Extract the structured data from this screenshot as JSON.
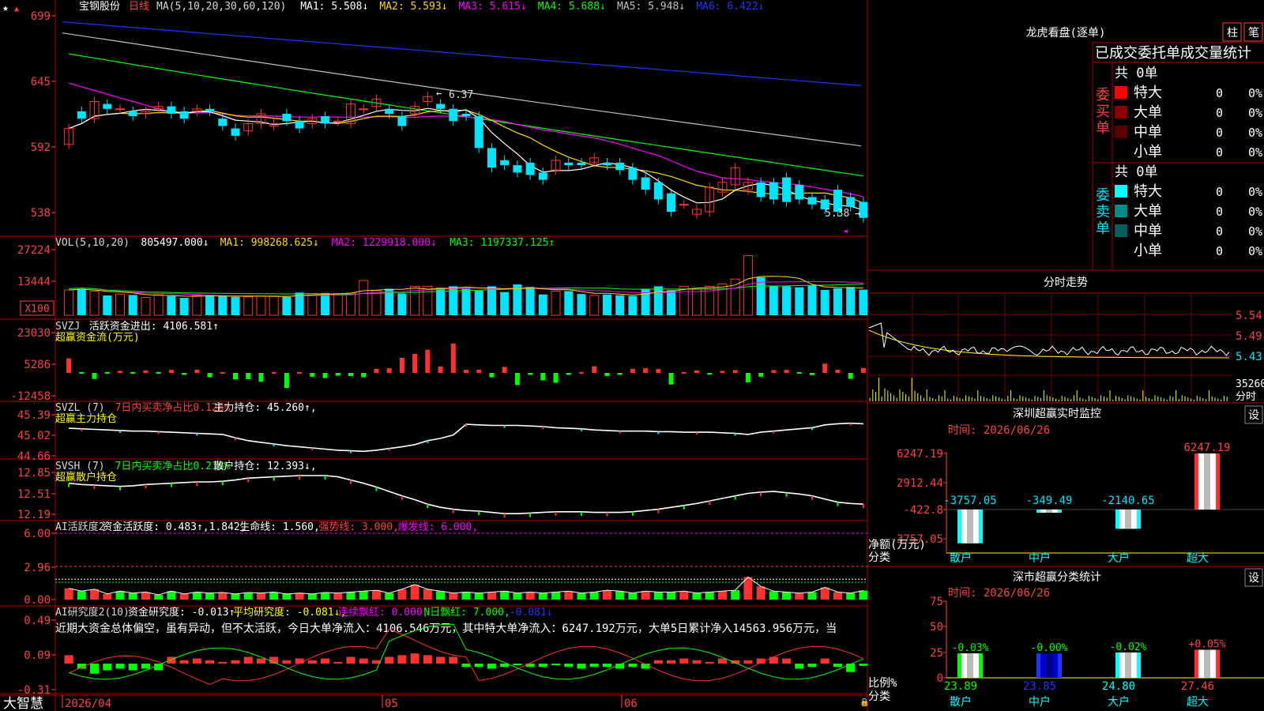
{
  "app": {
    "brand": "大智慧"
  },
  "stock": {
    "name": "宝钢股份",
    "period": "日线"
  },
  "colors": {
    "up": "#ff3232",
    "down": "#00e5ff",
    "ma1": "#ffffff",
    "ma2": "#ffd700",
    "ma3": "#ff00ff",
    "ma4": "#00ff00",
    "ma5": "#c0c0c0",
    "ma6": "#1f35ff",
    "grid": "#b00000",
    "axis": "#ff4040",
    "green": "#00ff00",
    "yellow": "#ffff00"
  },
  "main_panel": {
    "legend": [
      {
        "text": "MA(5,10,20,30,60,120)",
        "color": "#d8d8d8"
      },
      {
        "text": "MA1: 5.508↓",
        "color": "#ffffff"
      },
      {
        "text": "MA2: 5.593↓",
        "color": "#ffd700"
      },
      {
        "text": "MA3: 5.615↓",
        "color": "#ff00ff"
      },
      {
        "text": "MA4: 5.688↓",
        "color": "#00ff00"
      },
      {
        "text": "MA5: 5.948↓",
        "color": "#c0c0c0"
      },
      {
        "text": "MA6: 6.422↓",
        "color": "#1f35ff"
      }
    ],
    "yticks": [
      "699",
      "645",
      "592",
      "538"
    ],
    "high_label": "6.37",
    "low_label": "5.38"
  },
  "vol_panel": {
    "legend": [
      {
        "text": "VOL(5,10,20)",
        "color": "#d8d8d8"
      },
      {
        "text": "805497.000↓",
        "color": "#ffffff"
      },
      {
        "text": "MA1: 998268.625↓",
        "color": "#ffd700"
      },
      {
        "text": "MA2: 1229918.000↓",
        "color": "#ff00ff"
      },
      {
        "text": "MA3: 1197337.125↑",
        "color": "#00ff00"
      }
    ],
    "yticks": [
      "27224",
      "13444"
    ],
    "unit": "X100"
  },
  "svzj_panel": {
    "legend": [
      {
        "text": "SVZJ",
        "color": "#d8d8d8"
      },
      {
        "text": "活跃资金进出: 4106.581↑",
        "color": "#ffffff"
      }
    ],
    "subtitle": "超赢资金流(万元)",
    "yticks": [
      "23030",
      "5286",
      "-12458"
    ]
  },
  "svzl_panel": {
    "legend": [
      {
        "text": "SVZL (7)",
        "color": "#d8d8d8"
      },
      {
        "text": "7日内买卖净占比0.126%",
        "color": "#ff4040"
      },
      {
        "text": "主力持仓: 45.260↑,",
        "color": "#ffffff"
      }
    ],
    "subtitle": "超赢主力持仓",
    "yticks": [
      "45.39",
      "45.02",
      "44.66"
    ]
  },
  "svsh_panel": {
    "legend": [
      {
        "text": "SVSH (7)",
        "color": "#d8d8d8"
      },
      {
        "text": "7日内买卖净占比0.216%",
        "color": "#00ff00"
      },
      {
        "text": "散户持仓: 12.393↓,",
        "color": "#ffffff"
      }
    ],
    "subtitle": "超赢散户持仓",
    "yticks": [
      "12.85",
      "12.51",
      "12.19"
    ]
  },
  "ai_panel": {
    "legend": [
      {
        "text": "AI活跃度2",
        "color": "#d8d8d8"
      },
      {
        "text": "资金活跃度: 0.483↑,1.842,",
        "color": "#ffffff"
      },
      {
        "text": "生命线: 1.560,",
        "color": "#ffffff"
      },
      {
        "text": "强势线: 3.000,",
        "color": "#ff4040"
      },
      {
        "text": "爆发线: 6.000,",
        "color": "#ff00ff"
      }
    ],
    "yticks": [
      "6.00",
      "2.96",
      "0.00"
    ]
  },
  "research_panel": {
    "legend": [
      {
        "text": "AI研究度2(10)",
        "color": "#d8d8d8"
      },
      {
        "text": "资金研究度: -0.013↑,",
        "color": "#ffffff"
      },
      {
        "text": "平均研究度: -0.081↓,",
        "color": "#ffff00"
      },
      {
        "text": "连续飘红: 0.000,",
        "color": "#ff00ff"
      },
      {
        "text": "N日飘红: 7.000,",
        "color": "#00ff00"
      },
      {
        "text": "-0.081↓",
        "color": "#1f35ff"
      }
    ],
    "comment": "近期大资金总体偏空，虽有异动，但不太活跃，今日大单净流入：4106.546万元，其中特大单净流入：6247.192万元，大单5日累计净入14563.956万元，当",
    "yticks": [
      "0.49",
      "0.09",
      "-0.31"
    ]
  },
  "xaxis": {
    "labels": [
      "2026/04",
      "05",
      "06"
    ]
  },
  "right": {
    "dragon_title": "龙虎看盘(逐单)",
    "btn_bar": "柱",
    "btn_pen": "笔",
    "stats_title": "已成交委托单成交量统计",
    "buy_group": "委买单",
    "sell_group": "委卖单",
    "buy_total": "共 0单",
    "sell_total": "共 0单",
    "buy_rows": [
      {
        "label": "特大",
        "count": "0",
        "pct": "0%",
        "color": "#ff0000"
      },
      {
        "label": "大单",
        "count": "0",
        "pct": "0%",
        "color": "#8b0000"
      },
      {
        "label": "中单",
        "count": "0",
        "pct": "0%",
        "color": "#5a0000"
      },
      {
        "label": "小单",
        "count": "0",
        "pct": "0%",
        "color": ""
      }
    ],
    "sell_rows": [
      {
        "label": "特大",
        "count": "0",
        "pct": "0%",
        "color": "#00ffff"
      },
      {
        "label": "大单",
        "count": "0",
        "pct": "0%",
        "color": "#008b8b"
      },
      {
        "label": "中单",
        "count": "0",
        "pct": "0%",
        "color": "#006060"
      },
      {
        "label": "小单",
        "count": "0",
        "pct": "0%",
        "color": ""
      }
    ],
    "minute_title": "分时走势",
    "minute_yticks": [
      "5.54",
      "5.49",
      "5.43"
    ],
    "minute_vol": "35260",
    "minute_unit": "分时",
    "monitor_title": "深圳超赢实时监控",
    "monitor_date": "时间: 2026/06/26",
    "monitor_yticks": [
      "6247.19",
      "2912.44",
      "-422.8",
      "-3757.05"
    ],
    "monitor_ylabel": "净额(万元)",
    "monitor_xlabel": "分类",
    "categories": [
      "散户",
      "中户",
      "大户",
      "超大"
    ],
    "monitor_values": [
      -3757.05,
      -349.49,
      -2140.65,
      6247.19
    ],
    "monitor_labels": [
      "-3757.05",
      "-349.49",
      "-2140.65",
      "6247.19"
    ],
    "classify_title": "深市超赢分类统计",
    "classify_date": "时间: 2026/06/26",
    "classify_yticks": [
      "75",
      "50",
      "25",
      "0"
    ],
    "classify_ylabel": "比例%",
    "classify_xlabel": "分类",
    "classify_values": [
      23.89,
      23.85,
      24.8,
      27.46
    ],
    "classify_value_labels": [
      "23.89",
      "23.85",
      "24.80",
      "27.46"
    ],
    "classify_change_labels": [
      "-0.03%",
      "-0.00%",
      "-0.02%",
      "+0.05%"
    ],
    "settings_label": "设"
  },
  "chart_data": [
    {
      "type": "candlestick",
      "title": "宝钢股份 日线",
      "ylim": [
        5.3,
        7.05
      ],
      "x_range": [
        "2026/04",
        "2026/06"
      ],
      "series": [
        {
          "name": "price",
          "open": [
            5.95,
            6.22,
            6.16,
            6.28,
            6.24,
            6.22,
            6.2,
            6.24,
            6.26,
            6.22,
            6.22,
            6.24,
            6.16,
            6.08,
            6.06,
            6.12,
            6.1,
            6.2,
            6.14,
            6.12,
            6.18,
            6.14,
            6.12,
            6.24,
            6.26,
            6.24,
            6.18,
            6.2,
            6.3,
            6.28,
            6.24,
            6.2,
            6.18,
            5.92,
            5.82,
            5.78,
            5.8,
            5.72,
            5.74,
            5.8,
            5.8,
            5.8,
            5.8,
            5.8,
            5.76,
            5.68,
            5.64,
            5.55,
            5.46,
            5.38,
            5.4,
            5.56,
            5.62,
            5.58,
            5.64,
            5.64,
            5.68,
            5.62,
            5.52,
            5.5,
            5.58,
            5.52,
            5.48
          ],
          "close": [
            6.08,
            6.16,
            6.3,
            6.24,
            6.24,
            6.18,
            6.22,
            6.26,
            6.2,
            6.16,
            6.24,
            6.22,
            6.1,
            6.02,
            6.12,
            6.2,
            6.12,
            6.14,
            6.08,
            6.16,
            6.12,
            6.14,
            6.28,
            6.24,
            6.32,
            6.2,
            6.1,
            6.26,
            6.34,
            6.24,
            6.14,
            6.18,
            5.92,
            5.76,
            5.78,
            5.72,
            5.7,
            5.66,
            5.82,
            5.78,
            5.78,
            5.84,
            5.78,
            5.74,
            5.66,
            5.58,
            5.5,
            5.4,
            5.46,
            5.42,
            5.6,
            5.64,
            5.76,
            5.64,
            5.52,
            5.5,
            5.48,
            5.5,
            5.46,
            5.42,
            5.4,
            5.44,
            5.35
          ]
        },
        {
          "name": "MA1",
          "label": "MA1: 5.508↓"
        },
        {
          "name": "MA2",
          "label": "MA2: 5.593↓"
        },
        {
          "name": "MA3",
          "label": "MA3: 5.615↓"
        },
        {
          "name": "MA4",
          "label": "MA4: 5.688↓"
        },
        {
          "name": "MA5",
          "label": "MA5: 5.948↓"
        },
        {
          "name": "MA6",
          "label": "MA6: 6.422↓"
        }
      ]
    },
    {
      "type": "bar",
      "title": "VOL(5,10,20)",
      "ylim": [
        0,
        30000
      ],
      "values": [
        10500,
        11000,
        10000,
        8200,
        8800,
        8400,
        7400,
        8500,
        8000,
        7200,
        8200,
        8400,
        8000,
        7600,
        7600,
        8000,
        8000,
        7600,
        9400,
        9000,
        9200,
        9000,
        9200,
        14400,
        10200,
        11000,
        9000,
        12000,
        12000,
        11400,
        12000,
        11000,
        10200,
        12000,
        9600,
        12800,
        11800,
        8600,
        10000,
        10000,
        8800,
        8200,
        8600,
        8300,
        8000,
        11000,
        12000,
        10400,
        12000,
        10800,
        12000,
        13000,
        15000,
        24800,
        15800,
        12300,
        12000,
        11600,
        12400,
        10500,
        11200,
        11700,
        10600
      ],
      "ma": [
        "MA1: 998268.625↓",
        "MA2: 1229918.000↓",
        "MA3: 1197337.125↑"
      ]
    },
    {
      "type": "bar",
      "title": "SVZJ",
      "ylim": [
        -12458,
        23030
      ],
      "values": [
        7200,
        0,
        -3000,
        0,
        1000,
        0,
        1200,
        0,
        1500,
        -1000,
        1600,
        -2200,
        0,
        -3300,
        -3100,
        -4400,
        0,
        -7500,
        0,
        -1900,
        -2600,
        -1400,
        -1600,
        -2200,
        2000,
        2300,
        7500,
        9500,
        11500,
        3200,
        14600,
        1500,
        1600,
        -2200,
        3000,
        -6000,
        -1000,
        -3700,
        -4900,
        -1000,
        0,
        3300,
        -1600,
        -1000,
        2000,
        2300,
        1900,
        -5800,
        0,
        1200,
        -900,
        1000,
        1400,
        -4700,
        -1900,
        1400,
        1500,
        0,
        -1100,
        4600,
        1600,
        -2900,
        2400
      ],
      "ma": []
    },
    {
      "type": "line",
      "title": "SVZL (7)",
      "ylim": [
        44.66,
        45.39
      ],
      "values": [
        45.15,
        45.14,
        45.13,
        45.12,
        45.11,
        45.1,
        45.1,
        45.09,
        45.08,
        45.07,
        45.06,
        45.05,
        45.04,
        44.98,
        44.93,
        44.9,
        44.87,
        44.84,
        44.82,
        44.8,
        44.78,
        44.76,
        44.75,
        44.74,
        44.76,
        44.79,
        44.82,
        44.86,
        44.93,
        44.97,
        45.03,
        45.22,
        45.21,
        45.2,
        45.2,
        45.2,
        45.19,
        45.18,
        45.16,
        45.15,
        45.14,
        45.12,
        45.11,
        45.1,
        45.1,
        45.1,
        45.09,
        45.09,
        45.08,
        45.08,
        45.08,
        45.07,
        45.06,
        45.04,
        45.08,
        45.1,
        45.12,
        45.14,
        45.16,
        45.21,
        45.23,
        45.24,
        45.23
      ]
    },
    {
      "type": "line",
      "title": "SVSH (7)",
      "ylim": [
        12.19,
        12.85
      ],
      "values": [
        12.68,
        12.66,
        12.65,
        12.64,
        12.63,
        12.64,
        12.66,
        12.67,
        12.68,
        12.69,
        12.7,
        12.7,
        12.71,
        12.73,
        12.76,
        12.77,
        12.78,
        12.79,
        12.8,
        12.8,
        12.8,
        12.78,
        12.73,
        12.68,
        12.62,
        12.55,
        12.48,
        12.42,
        12.35,
        12.3,
        12.27,
        12.25,
        12.24,
        12.22,
        12.2,
        12.2,
        12.21,
        12.22,
        12.23,
        12.23,
        12.23,
        12.22,
        12.22,
        12.22,
        12.23,
        12.25,
        12.27,
        12.3,
        12.33,
        12.36,
        12.4,
        12.44,
        12.48,
        12.52,
        12.54,
        12.55,
        12.53,
        12.51,
        12.48,
        12.43,
        12.38,
        12.36,
        12.35
      ]
    },
    {
      "type": "bar",
      "title": "AI活跃度2",
      "ylim": [
        0,
        6.0
      ],
      "values": [
        0.6,
        0.45,
        0.55,
        0.3,
        0.45,
        0.35,
        0.4,
        0.25,
        0.45,
        0.3,
        0.4,
        0.35,
        0.38,
        0.3,
        0.38,
        0.35,
        0.4,
        0.3,
        0.35,
        0.3,
        0.38,
        0.35,
        0.4,
        0.45,
        0.5,
        0.35,
        0.55,
        0.8,
        0.55,
        0.45,
        0.35,
        0.4,
        0.35,
        0.4,
        0.45,
        0.35,
        0.4,
        0.35,
        0.4,
        0.45,
        0.35,
        0.4,
        0.5,
        0.45,
        0.35,
        0.45,
        0.4,
        0.4,
        0.45,
        0.35,
        0.4,
        0.45,
        0.5,
        1.2,
        0.7,
        0.45,
        0.4,
        0.35,
        0.4,
        0.65,
        0.4,
        0.35,
        0.48
      ],
      "lines": [
        "生命线: 1.560",
        "强势线: 3.000",
        "爆发线: 6.000"
      ]
    },
    {
      "type": "bar",
      "title": "AI研究度2(10)",
      "ylim": [
        -0.31,
        0.49
      ],
      "values": [
        0.05,
        -0.03,
        -0.06,
        -0.04,
        -0.03,
        -0.04,
        -0.03,
        -0.04,
        0.04,
        0.02,
        0.03,
        0.02,
        0.01,
        0.02,
        0.04,
        0.03,
        0.04,
        0.02,
        0.03,
        0.02,
        0.03,
        0.01,
        0.04,
        0.03,
        0.02,
        0.04,
        0.05,
        0.06,
        0.05,
        0.04,
        0.04,
        -0.02,
        -0.02,
        -0.03,
        -0.02,
        -0.01,
        -0.02,
        -0.02,
        -0.01,
        -0.02,
        -0.03,
        -0.02,
        -0.02,
        -0.03,
        -0.02,
        -0.03,
        0.02,
        0.02,
        0.03,
        0.02,
        0.01,
        0.03,
        0.02,
        0.02,
        0.03,
        0.04,
        0.03,
        -0.03,
        -0.02,
        0.03,
        -0.02,
        -0.05,
        -0.013
      ]
    }
  ]
}
